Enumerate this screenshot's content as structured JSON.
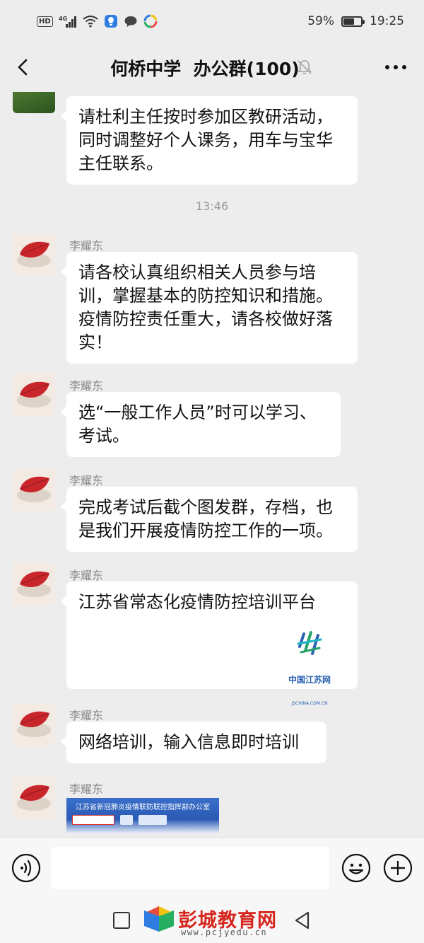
{
  "status_bar": {
    "signal_label": "4G",
    "battery_text": "59%",
    "battery_level": 0.59,
    "time": "19:25"
  },
  "header": {
    "title": "何桥中学  办公群(100)"
  },
  "messages": [
    {
      "text": "请杜利主任按时参加区教研活动，\n同时调整好个人课务，用车与宝华\n主任联系。"
    },
    {
      "sender": "李耀东",
      "text": "请各校认真组织相关人员参与培\n训，掌握基本的防控知识和措施。\n疫情防控责任重大，请各校做好落\n实！"
    },
    {
      "sender": "李耀东",
      "text": "选“一般工作人员”时可以学习、\n考试。"
    },
    {
      "sender": "李耀东",
      "text": "完成考试后截个图发群，存档，也\n是我们开展疫情防控工作的一项。"
    },
    {
      "sender": "李耀东",
      "text": "江苏省常态化疫情防控培训平台",
      "logo_name": "中国江苏网",
      "logo_url": "JSCHINA.COM.CN"
    },
    {
      "sender": "李耀东",
      "text": "网络培训，输入信息即时培训"
    },
    {
      "sender": "李耀东",
      "image_caption": "江苏省新冠肺炎疫情联防联控指挥部办公室"
    }
  ],
  "timestamp": "13:46",
  "watermark": {
    "name": "彭城教育网",
    "url": "www.pcjyedu.cn"
  }
}
